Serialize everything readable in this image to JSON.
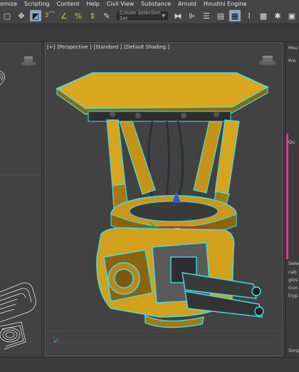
{
  "menu": [
    "omize",
    "Scripting",
    "Content",
    "Help",
    "Civil View",
    "Substance",
    "Arnold",
    "Houdini Engine"
  ],
  "toolbar": {
    "selection_set_placeholder": "Create Selection Set",
    "dropdown_arrow": "▼"
  },
  "viewport": {
    "labels": [
      "[+]",
      "[Perspective ]",
      "[Standard ]",
      "[Default Shading ]"
    ]
  },
  "panel": {
    "header": "Hou",
    "items": [
      "Pro",
      "",
      "",
      "",
      "",
      "",
      "",
      "Qu",
      "Selec",
      "cab",
      "glos",
      "Gun",
      "tryp",
      "Simp"
    ]
  },
  "colors": {
    "selection_outline": "#40e0e8",
    "accent": "#e8358c",
    "model_yellow": "#d9a81e"
  }
}
